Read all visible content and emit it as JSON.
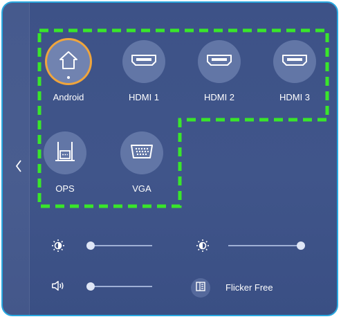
{
  "sources": [
    {
      "label": "Android",
      "icon": "home-icon",
      "active": true
    },
    {
      "label": "HDMI 1",
      "icon": "hdmi-icon",
      "active": false
    },
    {
      "label": "HDMI 2",
      "icon": "hdmi-icon",
      "active": false
    },
    {
      "label": "HDMI 3",
      "icon": "hdmi-icon",
      "active": false
    },
    {
      "label": "OPS",
      "icon": "ops-router-icon",
      "active": false
    },
    {
      "label": "VGA",
      "icon": "vga-icon",
      "active": false
    }
  ],
  "controls": {
    "brightness_left": {
      "icon": "brightness-icon",
      "level": 0.05
    },
    "brightness_right": {
      "icon": "contrast-icon",
      "level": 0.95
    },
    "volume": {
      "icon": "speaker-icon",
      "level": 0.05
    },
    "flicker": {
      "icon": "flicker-free-icon",
      "label": "Flicker Free"
    }
  },
  "colors": {
    "panel_border": "#29a8e0",
    "highlight_dash": "#39e62a",
    "active_ring": "#f0a53c"
  }
}
